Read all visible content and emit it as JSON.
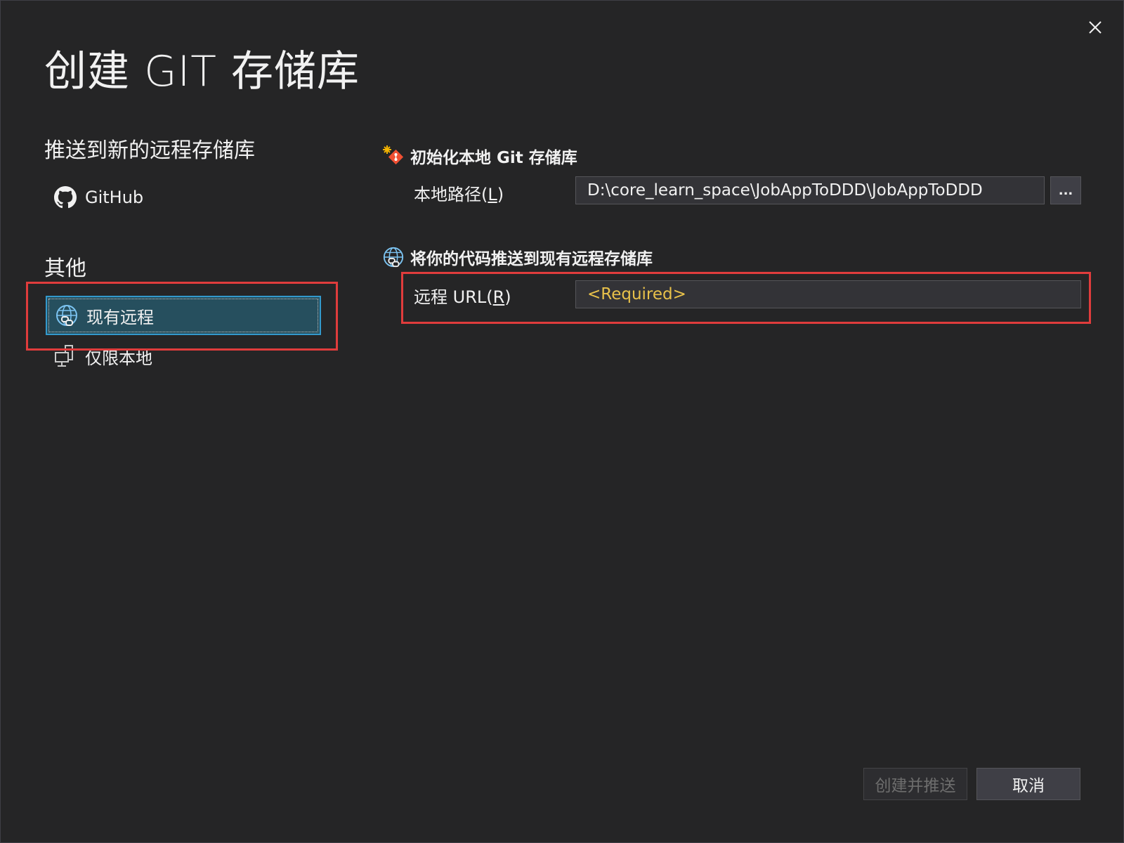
{
  "dialog": {
    "title": "创建 GIT 存储库",
    "close_icon": "close-icon"
  },
  "sidebar": {
    "push_heading": "推送到新的远程存储库",
    "github_label": "GitHub",
    "other_heading": "其他",
    "existing_remote_label": "现有远程",
    "local_only_label": "仅限本地",
    "selected_item": "现有远程"
  },
  "init_section": {
    "header": "初始化本地 Git 存储库",
    "local_path_label": "本地路径(",
    "local_path_accel": "L",
    "local_path_close": ")",
    "local_path_value": "D:\\core_learn_space\\JobAppToDDD\\JobAppToDDD",
    "browse_label": "..."
  },
  "push_section": {
    "header": "将你的代码推送到现有远程存储库",
    "remote_url_label": "远程 URL(",
    "remote_url_accel": "R",
    "remote_url_close": ")",
    "remote_url_value": "",
    "remote_url_placeholder": "<Required>"
  },
  "footer": {
    "create_push_label": "创建并推送",
    "cancel_label": "取消"
  },
  "colors": {
    "background": "#252526",
    "selected_bg": "#264f5e",
    "selected_border": "#3399cc",
    "highlight_red": "#e03c3c",
    "required_placeholder": "#e8c14a",
    "git_icon": "#f05033"
  }
}
